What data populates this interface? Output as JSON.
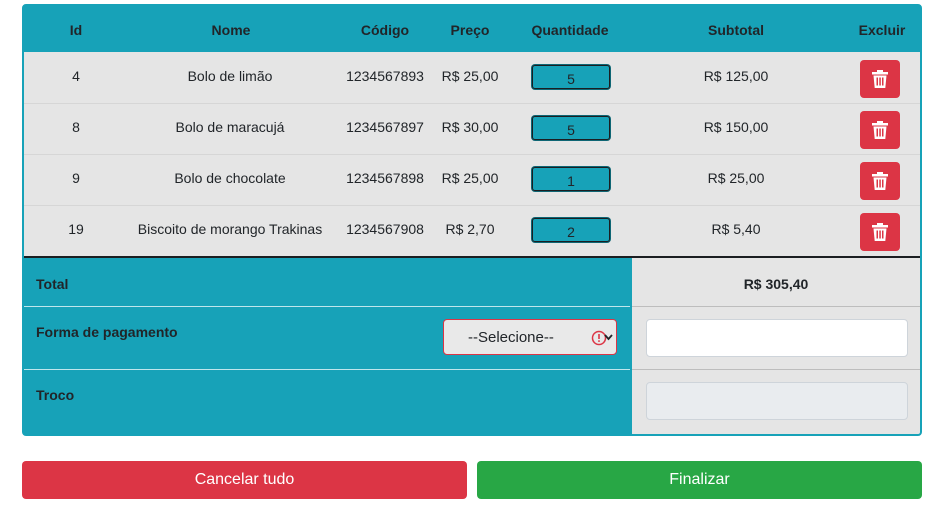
{
  "table": {
    "headers": {
      "id": "Id",
      "nome": "Nome",
      "codigo": "Código",
      "preco": "Preço",
      "quantidade": "Quantidade",
      "subtotal": "Subtotal",
      "excluir": "Excluir"
    },
    "rows": [
      {
        "id": "4",
        "nome": "Bolo de limão",
        "codigo": "1234567893",
        "preco": "R$ 25,00",
        "quantidade": "5",
        "subtotal": "R$ 125,00"
      },
      {
        "id": "8",
        "nome": "Bolo de maracujá",
        "codigo": "1234567897",
        "preco": "R$ 30,00",
        "quantidade": "5",
        "subtotal": "R$ 150,00"
      },
      {
        "id": "9",
        "nome": "Bolo de chocolate",
        "codigo": "1234567898",
        "preco": "R$ 25,00",
        "quantidade": "1",
        "subtotal": "R$ 25,00"
      },
      {
        "id": "19",
        "nome": "Biscoito de morango Trakinas",
        "codigo": "1234567908",
        "preco": "R$ 2,70",
        "quantidade": "2",
        "subtotal": "R$ 5,40"
      }
    ]
  },
  "footer": {
    "total_label": "Total",
    "total_value": "R$ 305,40",
    "payment_label": "Forma de pagamento",
    "payment_select": "--Selecione--",
    "payment_input": "",
    "change_label": "Troco",
    "change_input": ""
  },
  "buttons": {
    "cancel": "Cancelar tudo",
    "finish": "Finalizar"
  },
  "icons": {
    "delete": "trash-icon",
    "error": "exclamation-circle-icon",
    "dropdown": "chevron-down-icon"
  },
  "colors": {
    "primary": "#17a2b8",
    "danger": "#dc3545",
    "success": "#28a745",
    "row_bg": "#e5e5e5"
  }
}
